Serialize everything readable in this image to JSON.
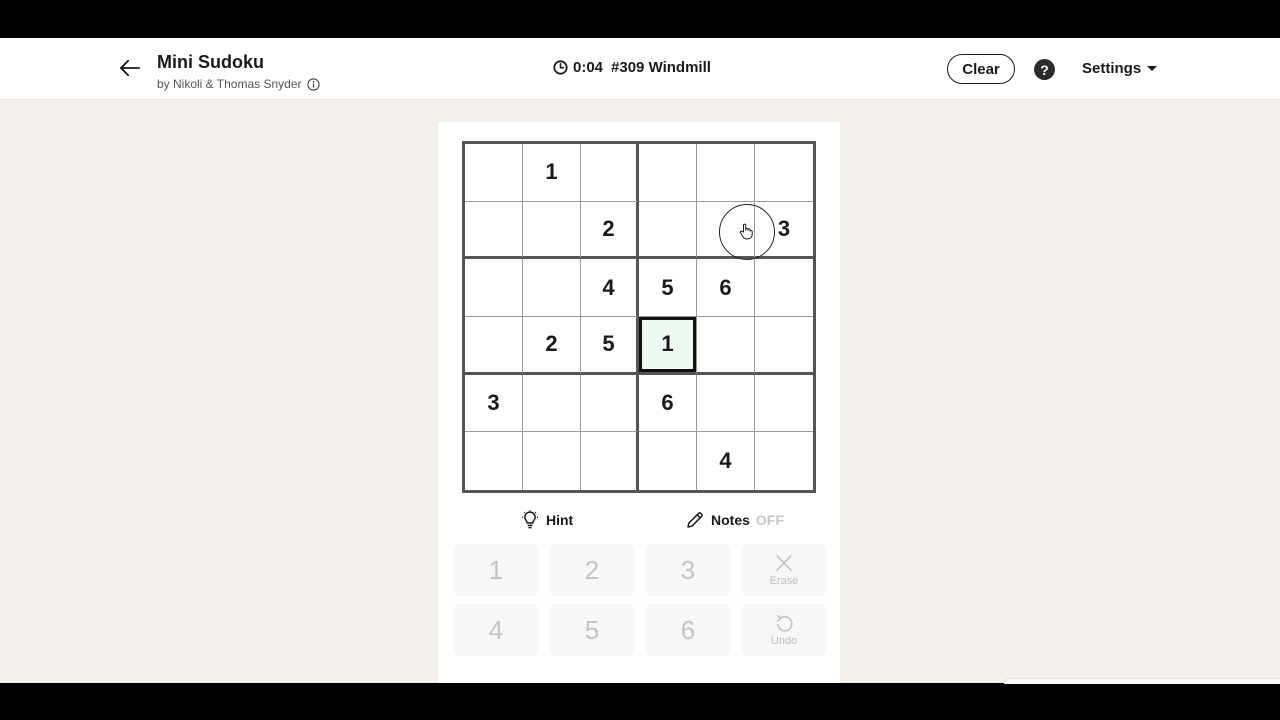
{
  "header": {
    "title": "Mini Sudoku",
    "byline": "by Nikoli & Thomas Snyder",
    "timer": "0:04",
    "puzzle": "#309 Windmill",
    "clear_label": "Clear",
    "help_label": "?",
    "settings_label": "Settings"
  },
  "board": {
    "rows": [
      [
        "",
        "1",
        "",
        "",
        "",
        ""
      ],
      [
        "",
        "",
        "2",
        "",
        "",
        "3"
      ],
      [
        "",
        "",
        "4",
        "5",
        "6",
        ""
      ],
      [
        "",
        "2",
        "5",
        "1",
        "",
        ""
      ],
      [
        "3",
        "",
        "",
        "6",
        "",
        ""
      ],
      [
        "",
        "",
        "",
        "",
        "4",
        ""
      ]
    ],
    "selected": {
      "row": 3,
      "col": 3
    }
  },
  "tools": {
    "hint_label": "Hint",
    "notes_label": "Notes",
    "notes_state": "OFF"
  },
  "keypad": {
    "keys": [
      "1",
      "2",
      "3",
      "4",
      "5",
      "6"
    ],
    "erase_label": "Erase",
    "undo_label": "Undo"
  },
  "icons": {
    "back": "arrow-left-icon",
    "info": "info-icon",
    "clock": "clock-icon",
    "help": "question-icon",
    "caret": "caret-down-icon",
    "hint": "lightbulb-icon",
    "notes": "pencil-icon",
    "erase": "x-icon",
    "undo": "undo-icon",
    "cursor": "hand-pointer-icon"
  },
  "colors": {
    "selected_cell_bg": "#eefaf1",
    "page_bg": "#f3f0ec",
    "disabled_key": "#c4c4c4"
  }
}
